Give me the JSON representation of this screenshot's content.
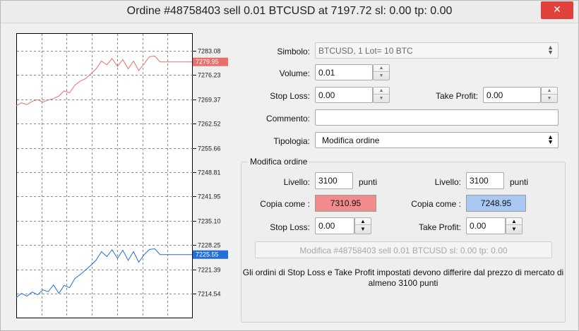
{
  "window": {
    "title": "Ordine #48758403 sell 0.01 BTCUSD at 7197.72 sl: 0.00 tp: 0.00",
    "close_glyph": "✕"
  },
  "chart": {
    "upper_ticks": [
      "7283.08",
      "7276.23",
      "7269.37",
      "7262.52",
      "7255.66",
      "7248.81",
      "7241.95",
      "7235.10",
      "7228.25",
      "7221.39",
      "7214.54"
    ],
    "bid_label": "7279.95",
    "ask_label": "7225.55",
    "bid_color": "#e8706a",
    "ask_color": "#1f6fd6",
    "bid_series": [
      7267.6,
      7268.4,
      7267.9,
      7268.8,
      7269.3,
      7268.6,
      7269.2,
      7269.6,
      7270.3,
      7271.8,
      7271.2,
      7273.4,
      7274.5,
      7275.2,
      7276.6,
      7278.0,
      7280.2,
      7279.1,
      7280.9,
      7278.7,
      7280.6,
      7278.0,
      7280.2,
      7277.5,
      7279.4,
      7281.4,
      7281.6,
      7279.95,
      7279.95,
      7279.95,
      7279.95,
      7279.95,
      7279.95,
      7279.95
    ],
    "ask_series": [
      7213.4,
      7214.6,
      7213.8,
      7215.0,
      7214.2,
      7215.6,
      7215.1,
      7217.0,
      7214.6,
      7216.9,
      7216.2,
      7218.8,
      7219.9,
      7221.2,
      7222.5,
      7224.0,
      7226.4,
      7225.0,
      7226.9,
      7224.5,
      7226.8,
      7223.9,
      7226.4,
      7223.4,
      7225.5,
      7227.0,
      7227.2,
      7225.55,
      7225.55,
      7225.55,
      7225.55,
      7225.55,
      7225.55,
      7225.55
    ]
  },
  "form": {
    "symbol_label": "Simbolo:",
    "symbol_value": "BTCUSD, 1 Lot= 10 BTC",
    "volume_label": "Volume:",
    "volume_value": "0.01",
    "stoploss_label": "Stop Loss:",
    "stoploss_value": "0.00",
    "takeprofit_label": "Take Profit:",
    "takeprofit_value": "0.00",
    "comment_label": "Commento:",
    "comment_value": "",
    "type_label": "Tipologia:",
    "type_value": "Modifica ordine"
  },
  "modify": {
    "group_title": "Modifica ordine",
    "level_label": "Livello:",
    "left_level": "3100",
    "right_level": "3100",
    "points_label": "punti",
    "copy_label": "Copia come :",
    "copy_sl": "7310.95",
    "copy_tp": "7248.95",
    "copy_sl_color": "#f28b8b",
    "copy_tp_color": "#a9c8f4",
    "sl_label": "Stop Loss:",
    "sl_value": "0.00",
    "tp_label": "Take Profit:",
    "tp_value": "0.00",
    "modify_button": "Modifica #48758403 sell 0.01 BTCUSD sl: 0.00 tp: 0.00",
    "note": "Gli ordini di Stop Loss e Take Profit impostati devono differire dal prezzo di mercato di almeno 3100 punti"
  }
}
